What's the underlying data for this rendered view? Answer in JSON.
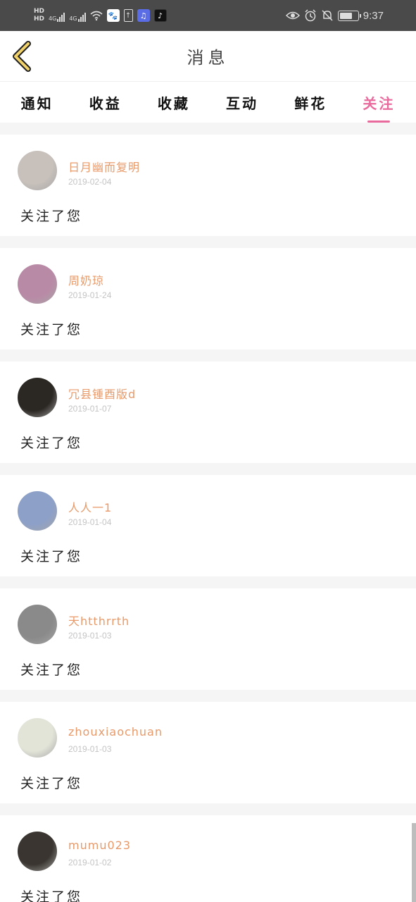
{
  "status_bar": {
    "hd_top": "HD",
    "hd_bottom": "HD",
    "net1": "4G",
    "net2": "4G",
    "time": "9:37",
    "icons": [
      "signal-icon",
      "signal-icon",
      "wifi-icon",
      "baidu-icon",
      "upload-icon",
      "music-icon",
      "tiktok-icon",
      "eye-icon",
      "alarm-icon",
      "mute-bell-icon",
      "battery-icon"
    ]
  },
  "header": {
    "title": "消息",
    "back_icon": "chevron-left-icon"
  },
  "tabs": [
    {
      "label": "通知",
      "active": false
    },
    {
      "label": "收益",
      "active": false
    },
    {
      "label": "收藏",
      "active": false
    },
    {
      "label": "互动",
      "active": false
    },
    {
      "label": "鲜花",
      "active": false
    },
    {
      "label": "关注",
      "active": true
    }
  ],
  "items": [
    {
      "name": "日月幽而复明",
      "date": "2019-02-04",
      "message": "关注了您",
      "avatar_color": "#c7c0bb"
    },
    {
      "name": "周奶琼",
      "date": "2019-01-24",
      "message": "关注了您",
      "avatar_color": "#b98aa6"
    },
    {
      "name": "冗县锺酉版d",
      "date": "2019-01-07",
      "message": "关注了您",
      "avatar_color": "#2b2723"
    },
    {
      "name": "人人一1",
      "date": "2019-01-04",
      "message": "关注了您",
      "avatar_color": "#8da0c8"
    },
    {
      "name": "天htthrrth",
      "date": "2019-01-03",
      "message": "关注了您",
      "avatar_color": "#8a8a8a"
    },
    {
      "name": "zhouxiaochuan",
      "date": "2019-01-03",
      "message": "关注了您",
      "avatar_color": "#e2e4d8"
    },
    {
      "name": "mumu023",
      "date": "2019-01-02",
      "message": "关注了您",
      "avatar_color": "#3a3530"
    }
  ],
  "colors": {
    "accent": "#e96a9c",
    "username": "#e89a6a",
    "date": "#c4c4c4",
    "back_arrow": "#f1d26a"
  }
}
